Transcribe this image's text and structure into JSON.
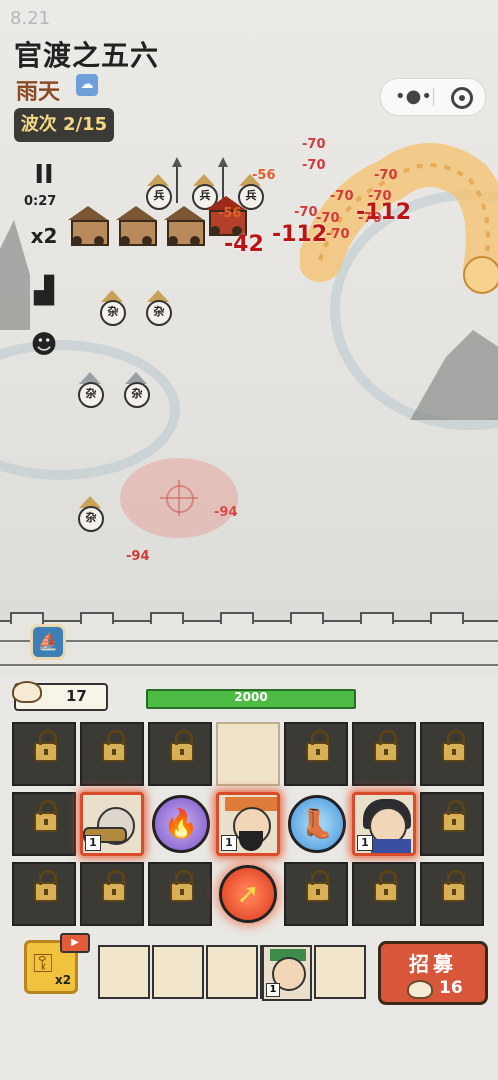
{
  "version": "8.21",
  "level_title": "官渡之五六",
  "weather": {
    "label": "雨天",
    "icon": "rain-cloud-icon"
  },
  "wave": {
    "label": "波次",
    "current": 2,
    "total": 15,
    "text": "波次 2/15"
  },
  "controls": {
    "pause": "II",
    "timer": "0:27",
    "speed": "x2",
    "stats_icon": "bar-chart-icon",
    "enemy_icon": "angry-face-icon"
  },
  "enemy_labels": {
    "soldier": "兵",
    "worker": "杂"
  },
  "damage_numbers": {
    "top_a": "-70",
    "top_b": "-70",
    "top_c": "-70",
    "top_d": "-70",
    "top_e": "-70",
    "top_f": "-70",
    "top_g": "-70",
    "top_h": "-70",
    "top_i": "-70",
    "n56a": "-56",
    "n56b": "-56",
    "big42": "-42",
    "big112a": "-112",
    "big112b": "-112",
    "n94a": "-94",
    "n94b": "-94"
  },
  "resources": {
    "buns": "17",
    "wall_hp": "2000",
    "wall_hp_fraction": 1.0
  },
  "grid": {
    "rows": 3,
    "cols": 7,
    "heroes": [
      {
        "level": "1",
        "name": "cannon-hero"
      },
      {
        "level": "1",
        "name": "guan-yu-hero-center"
      },
      {
        "level": "1",
        "name": "scythe-hero"
      }
    ],
    "skills": [
      "fire-orb-icon",
      "boot-orb-icon",
      "arrow-orb-icon"
    ]
  },
  "bench": {
    "key_multiplier": "x2",
    "video_badge": "▶",
    "hero_level": "1"
  },
  "recruit": {
    "label": "招募",
    "cost": "16"
  },
  "colors": {
    "danger": "#c72222",
    "hp": "#4cbc44",
    "recruit": "#d8573b",
    "grid_dark": "#3c3a35"
  }
}
